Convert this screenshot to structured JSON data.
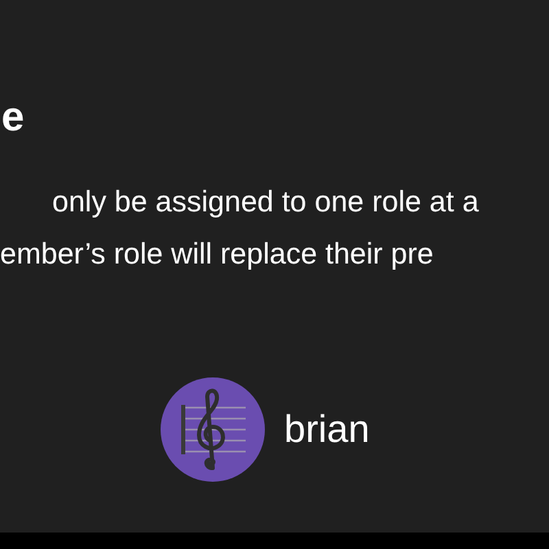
{
  "heading": "e",
  "description_lines": [
    "only be assigned to one role at a",
    "ember’s role will replace their pre"
  ],
  "member": {
    "name": "brian"
  }
}
